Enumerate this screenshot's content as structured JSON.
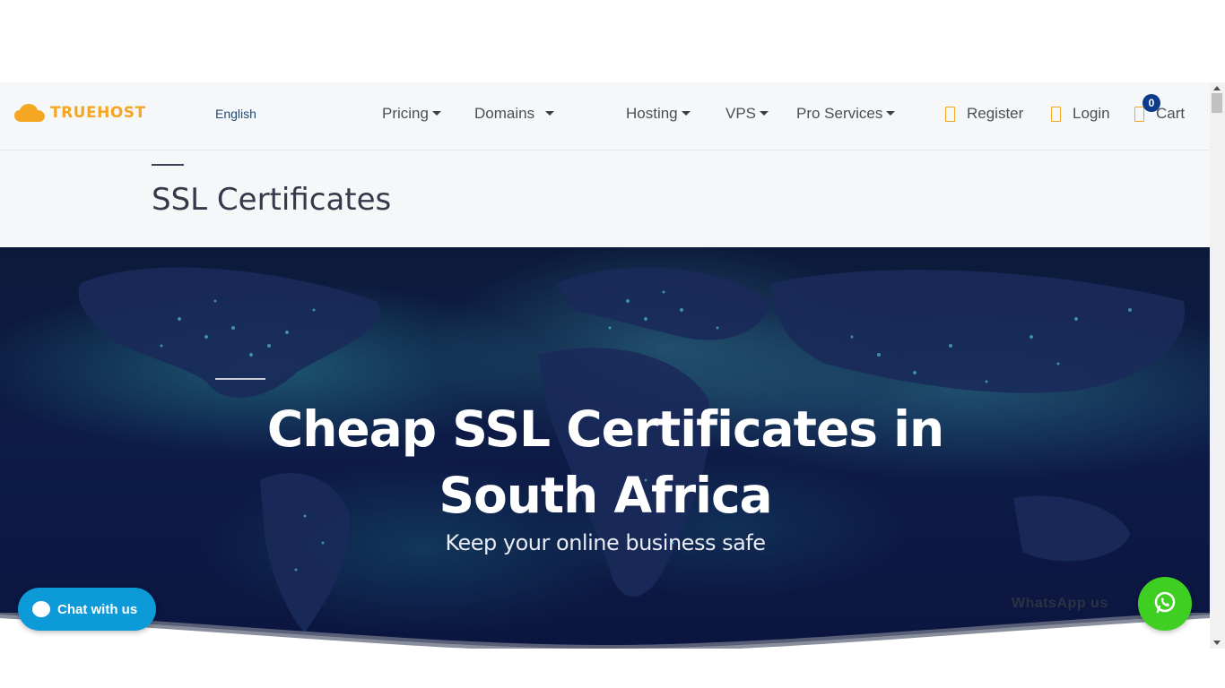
{
  "brand": {
    "name": "TRUEHOST",
    "color": "#f5a623"
  },
  "language": {
    "label": "English"
  },
  "nav": {
    "pricing": "Pricing",
    "domains": "Domains",
    "hosting": "Hosting",
    "vps": "VPS",
    "pro_services": "Pro Services"
  },
  "auth": {
    "register": "Register",
    "login": "Login",
    "cart": "Cart",
    "cart_count": "0"
  },
  "page": {
    "title": "SSL Certificates"
  },
  "hero": {
    "heading": "Cheap SSL Certificates in South Africa",
    "subheading": "Keep your online business safe"
  },
  "widgets": {
    "chat_label": "Chat with us",
    "whatsapp_label": "WhatsApp us",
    "chat_color": "#0c9ad8",
    "whatsapp_color": "#3fcf22"
  },
  "icons": {
    "logo": "cloud-icon",
    "caret": "caret-down-icon",
    "register": "user-icon",
    "login": "lock-icon",
    "cart": "cart-icon",
    "chat": "chat-bubble-icon",
    "whatsapp": "whatsapp-icon"
  }
}
